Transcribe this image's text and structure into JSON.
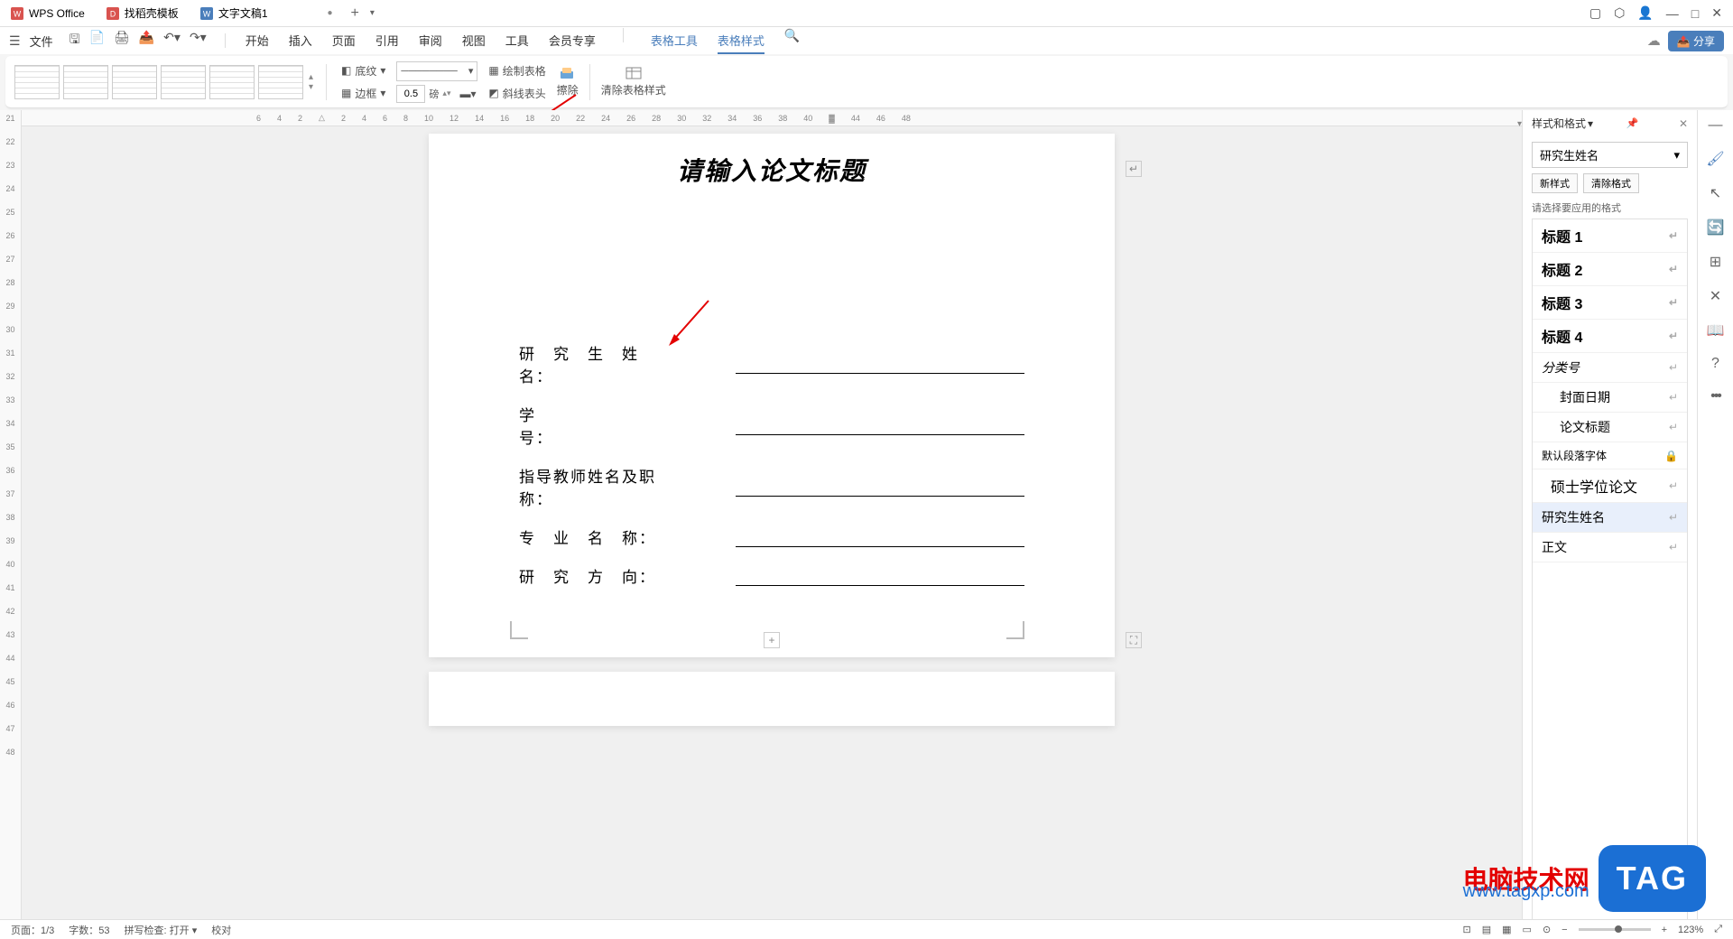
{
  "titleBar": {
    "tabs": [
      {
        "icon": "wps",
        "label": "WPS Office",
        "color": "#d9534f"
      },
      {
        "icon": "template",
        "label": "找稻壳模板",
        "color": "#d9534f"
      },
      {
        "icon": "doc",
        "label": "文字文稿1",
        "color": "#4a7ebb",
        "modified": "●"
      }
    ]
  },
  "menuBar": {
    "fileMenu": "文件",
    "tabs": [
      "开始",
      "插入",
      "页面",
      "引用",
      "审阅",
      "视图",
      "工具",
      "会员专享"
    ],
    "blueTabs": [
      "表格工具",
      "表格样式"
    ],
    "shareBtn": "分享"
  },
  "ribbon": {
    "shading": "底纹",
    "border": "边框",
    "lineWidth": "0.5",
    "lineUnit": "磅",
    "drawTable": "绘制表格",
    "diagLine": "斜线表头",
    "erase": "擦除",
    "clearStyle": "清除表格样式"
  },
  "rulerH": [
    "6",
    "4",
    "2",
    "",
    "2",
    "4",
    "6",
    "8",
    "10",
    "12",
    "14",
    "16",
    "18",
    "20",
    "22",
    "24",
    "26",
    "28",
    "30",
    "32",
    "34",
    "36",
    "38",
    "40",
    "",
    "44",
    "46",
    "48"
  ],
  "rulerV": [
    "2",
    "",
    "21",
    "22",
    "23",
    "24",
    "25",
    "26",
    "27",
    "28",
    "29",
    "30",
    "31",
    "32",
    "33",
    "34",
    "35",
    "36",
    "37",
    "38",
    "39",
    "40",
    "41",
    "42",
    "43",
    "44",
    "45",
    "46",
    "47",
    "48"
  ],
  "document": {
    "title": "请输入论文标题",
    "fields": [
      {
        "label": "研　究　生　姓　名："
      },
      {
        "label": "学　　　　　　　号："
      },
      {
        "label": "指导教师姓名及职称："
      },
      {
        "label": "专　业　名　称："
      },
      {
        "label": "研　究　方　向："
      }
    ]
  },
  "stylePanel": {
    "title": "样式和格式",
    "current": "研究生姓名",
    "newStyle": "新样式",
    "clearFormat": "清除格式",
    "hint": "请选择要应用的格式",
    "styles": [
      {
        "name": "标题 1",
        "bold": true
      },
      {
        "name": "标题 2",
        "bold": true
      },
      {
        "name": "标题 3",
        "bold": true
      },
      {
        "name": "标题 4",
        "bold": true
      },
      {
        "name": "分类号",
        "bold": false
      },
      {
        "name": "封面日期",
        "bold": false,
        "indent": true
      },
      {
        "name": "论文标题",
        "bold": false,
        "indent": true
      },
      {
        "name": "默认段落字体",
        "bold": false,
        "lock": true
      },
      {
        "name": "硕士学位论文",
        "bold": false,
        "indent": true
      },
      {
        "name": "研究生姓名",
        "bold": false,
        "selected": true
      },
      {
        "name": "正文",
        "bold": false
      }
    ]
  },
  "statusBar": {
    "page": "页面：1/3",
    "words": "字数：53",
    "spell": "拼写检查: 打开",
    "proof": "校对",
    "zoom": "123%"
  },
  "watermark": {
    "text": "电脑技术网",
    "url": "www.tagxp.com",
    "tag": "TAG"
  }
}
